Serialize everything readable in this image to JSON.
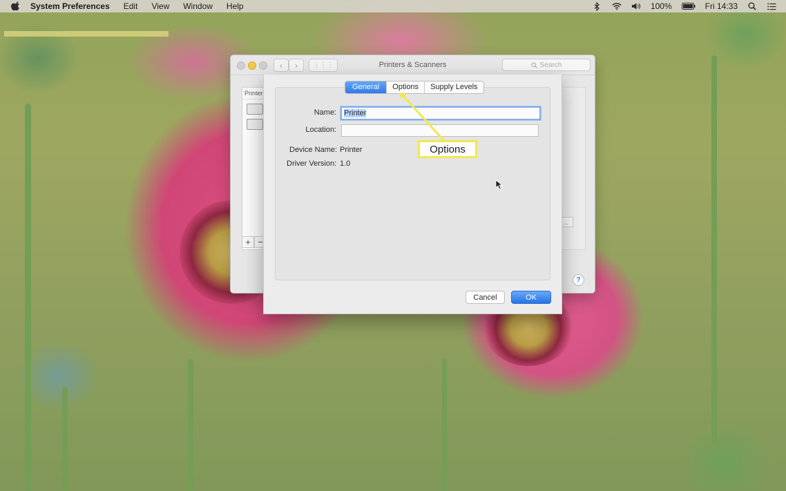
{
  "menubar": {
    "app_name": "System Preferences",
    "items": [
      "Edit",
      "View",
      "Window",
      "Help"
    ],
    "battery": "100%",
    "clock": "Fri 14:33"
  },
  "bg_window": {
    "title": "Printers & Scanners",
    "search_placeholder": "Search",
    "printers_header": "Printers",
    "add_label": "+",
    "remove_label": "−",
    "ellipsis_label": "...",
    "help_label": "?"
  },
  "sheet": {
    "tabs": [
      {
        "label": "General",
        "active": true
      },
      {
        "label": "Options",
        "active": false
      },
      {
        "label": "Supply Levels",
        "active": false
      }
    ],
    "name_label": "Name:",
    "name_value": "Printer",
    "location_label": "Location:",
    "location_value": "",
    "device_name_label": "Device Name:",
    "device_name_value": "Printer",
    "driver_version_label": "Driver Version:",
    "driver_version_value": "1.0",
    "cancel_label": "Cancel",
    "ok_label": "OK"
  },
  "annotation": {
    "label": "Options",
    "color": "#f1e84a"
  },
  "colors": {
    "accent_blue": "#2a76e8",
    "callout_yellow": "#f1e84a"
  }
}
